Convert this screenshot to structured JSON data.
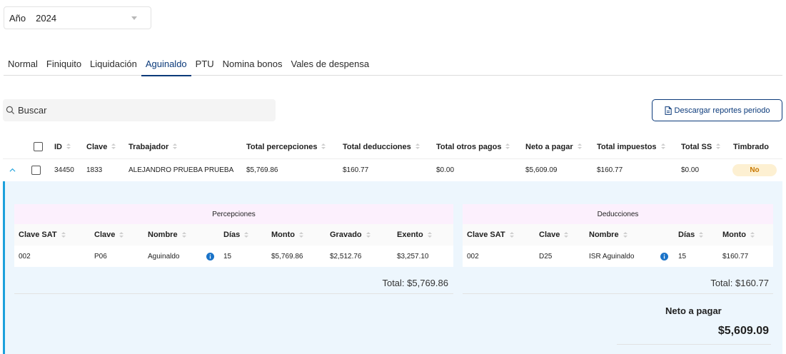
{
  "year_select": {
    "label": "Año",
    "value": "2024"
  },
  "tabs": [
    {
      "label": "Normal"
    },
    {
      "label": "Finiquito"
    },
    {
      "label": "Liquidación"
    },
    {
      "label": "Aguinaldo",
      "active": true
    },
    {
      "label": "PTU"
    },
    {
      "label": "Nomina bonos"
    },
    {
      "label": "Vales de despensa"
    }
  ],
  "search": {
    "placeholder": "Buscar"
  },
  "download_button": {
    "label": "Descargar reportes periodo",
    "color": "#0b3a7a"
  },
  "table": {
    "headers": {
      "id": "ID",
      "clave": "Clave",
      "trabajador": "Trabajador",
      "total_percepciones": "Total percepciones",
      "total_deducciones": "Total deducciones",
      "total_otros_pagos": "Total otros pagos",
      "neto_a_pagar": "Neto a pagar",
      "total_impuestos": "Total impuestos",
      "total_ss": "Total SS",
      "timbrado": "Timbrado"
    },
    "rows": [
      {
        "id": "34450",
        "clave": "1833",
        "trabajador": "ALEJANDRO PRUEBA PRUEBA",
        "total_percepciones": "$5,769.86",
        "total_deducciones": "$160.77",
        "total_otros_pagos": "$0.00",
        "neto_a_pagar": "$5,609.09",
        "total_impuestos": "$160.77",
        "total_ss": "$0.00",
        "timbrado": "No"
      }
    ]
  },
  "percepciones": {
    "title": "Percepciones",
    "headers": {
      "clave_sat": "Clave SAT",
      "clave": "Clave",
      "nombre": "Nombre",
      "dias": "Días",
      "monto": "Monto",
      "gravado": "Gravado",
      "exento": "Exento"
    },
    "rows": [
      {
        "clave_sat": "002",
        "clave": "P06",
        "nombre": "Aguinaldo",
        "dias": "15",
        "monto": "$5,769.86",
        "gravado": "$2,512.76",
        "exento": "$3,257.10"
      }
    ],
    "total": "Total: $5,769.86"
  },
  "deducciones": {
    "title": "Deducciones",
    "headers": {
      "clave_sat": "Clave SAT",
      "clave": "Clave",
      "nombre": "Nombre",
      "dias": "Días",
      "monto": "Monto"
    },
    "rows": [
      {
        "clave_sat": "002",
        "clave": "D25",
        "nombre": "ISR Aguinaldo",
        "dias": "15",
        "monto": "$160.77"
      }
    ],
    "total": "Total: $160.77"
  },
  "neto": {
    "label": "Neto a pagar",
    "value": "$5,609.09"
  },
  "colors": {
    "accent": "#0b3a7a",
    "expand_bg": "#edf6fd",
    "expand_border": "#1ba1dc",
    "badge_bg": "#fdf0d2",
    "badge_text": "#c77700",
    "info_icon": "#1a73c8"
  },
  "icons": {
    "search": "search-icon",
    "download": "document-icon",
    "expand": "chevron-up-icon",
    "info": "info-icon",
    "caret": "caret-down-icon"
  }
}
